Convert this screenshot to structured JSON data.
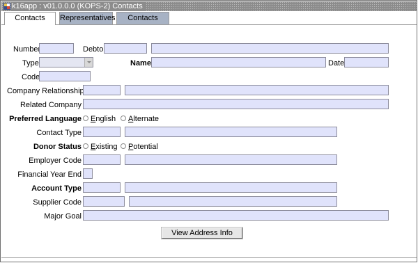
{
  "window": {
    "title": "k16app : v01.0.0.0 (KOPS-2) Contacts"
  },
  "tabs": [
    {
      "label": "Contacts",
      "active": true
    },
    {
      "label": "Representatives",
      "active": false
    },
    {
      "label": "Contacts",
      "active": false
    }
  ],
  "form": {
    "number_label": "Number",
    "debtor_label": "Debtor",
    "type_label": "Type",
    "name_label": "Name",
    "date_label": "Date",
    "code_label": "Code",
    "company_relationship_label": "Company Relationship",
    "related_company_label": "Related Company",
    "preferred_language_label": "Preferred Language",
    "language_options": [
      {
        "mnemonic": "E",
        "rest": "nglish",
        "selected": false
      },
      {
        "mnemonic": "A",
        "rest": "lternate",
        "selected": false
      }
    ],
    "contact_type_label": "Contact Type",
    "donor_status_label": "Donor Status",
    "donor_options": [
      {
        "mnemonic": "E",
        "rest": "xisting",
        "selected": false
      },
      {
        "mnemonic": "P",
        "rest": "otential",
        "selected": false
      }
    ],
    "employer_code_label": "Employer Code",
    "financial_year_end_label": "Financial Year End",
    "account_type_label": "Account Type",
    "supplier_code_label": "Supplier Code",
    "major_goal_label": "Major Goal",
    "values": {
      "number": "",
      "debtor_code": "",
      "debtor_name": "",
      "type": "",
      "name": "",
      "date": "",
      "code": "",
      "company_relationship_code": "",
      "company_relationship_desc": "",
      "related_company": "",
      "contact_type_code": "",
      "contact_type_desc": "",
      "employer_code": "",
      "employer_desc": "",
      "financial_year_end": "",
      "account_type_code": "",
      "account_type_desc": "",
      "supplier_code": "",
      "supplier_desc": "",
      "major_goal": ""
    }
  },
  "buttons": {
    "view_address_info": "View  Address Info"
  }
}
